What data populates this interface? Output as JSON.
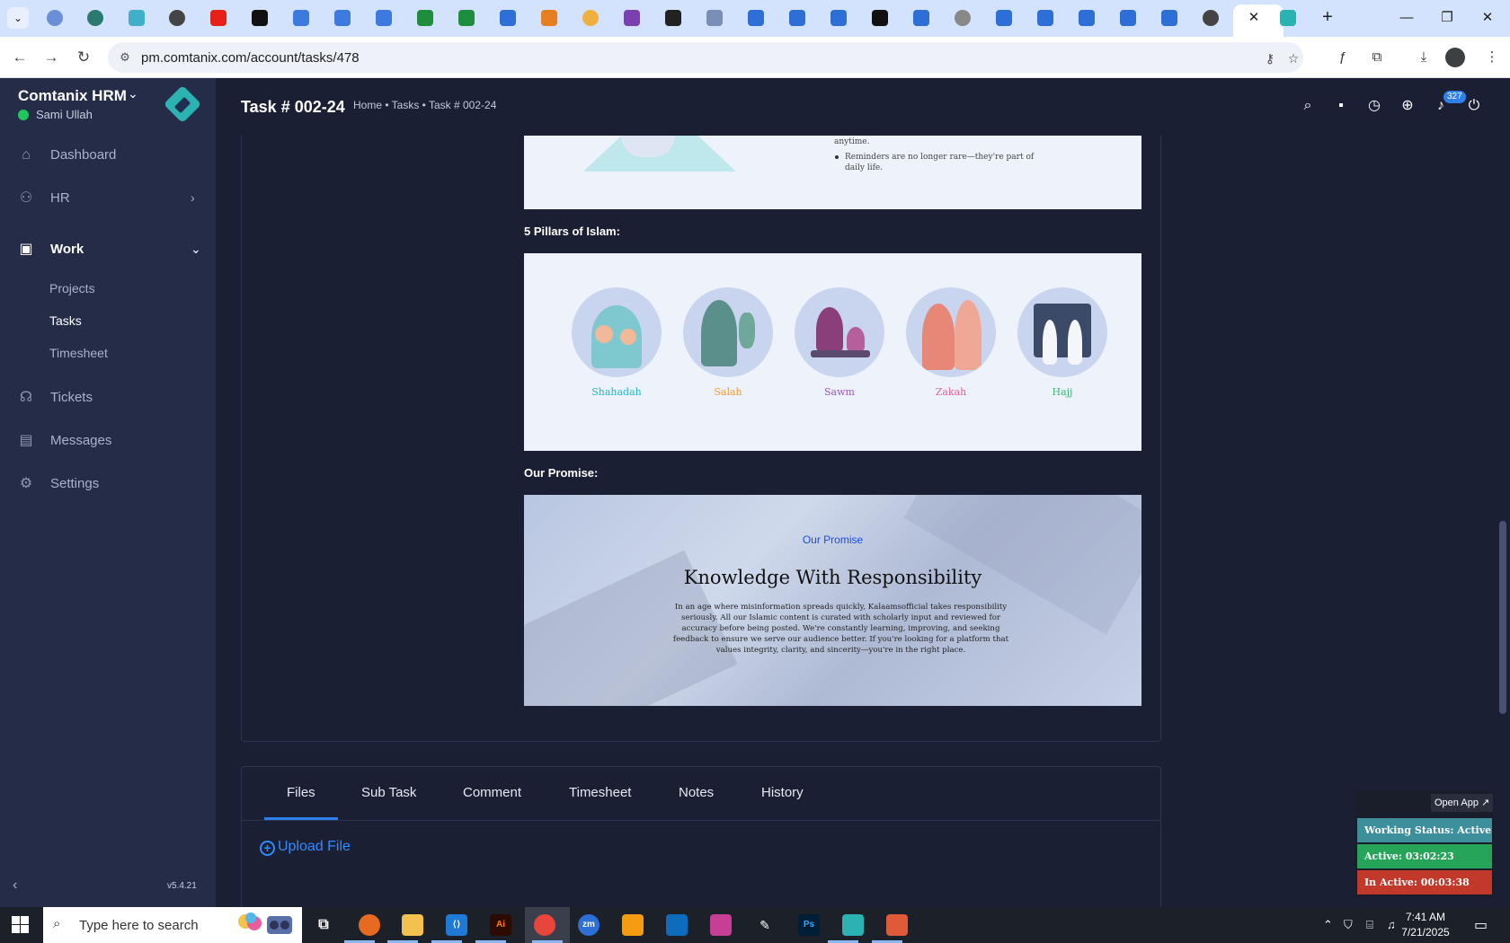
{
  "browser": {
    "url": "pm.comtanix.com/account/tasks/478",
    "tab_close_glyph": "✕",
    "new_tab_glyph": "+"
  },
  "sidebar": {
    "brand": "Comtanix HRM",
    "user": "Sami Ullah",
    "items": [
      {
        "label": "Dashboard",
        "icon": "home-icon"
      },
      {
        "label": "HR",
        "icon": "users-icon"
      },
      {
        "label": "Work",
        "icon": "briefcase-icon"
      },
      {
        "label": "Tickets",
        "icon": "headset-icon"
      },
      {
        "label": "Messages",
        "icon": "chat-icon"
      },
      {
        "label": "Settings",
        "icon": "gear-icon"
      }
    ],
    "work_sub": [
      "Projects",
      "Tasks",
      "Timesheet"
    ],
    "version": "v5.4.21"
  },
  "header": {
    "title": "Task # 002-24",
    "breadcrumb": "Home • Tasks • Task # 002-24",
    "notification_count": "327"
  },
  "content": {
    "top_bullets": {
      "first_line": "anytime.",
      "items": [
        "Reminders are no longer rare—they're part of daily life."
      ]
    },
    "pillars_heading": "5 Pillars of Islam:",
    "pillars": [
      {
        "label": "Shahadah",
        "color": "#22b8c8"
      },
      {
        "label": "Salah",
        "color": "#f39c3a"
      },
      {
        "label": "Sawm",
        "color": "#9b59c6"
      },
      {
        "label": "Zakah",
        "color": "#e9609a"
      },
      {
        "label": "Hajj",
        "color": "#2fbf71"
      }
    ],
    "promise_heading": "Our Promise:",
    "promise": {
      "eyebrow": "Our Promise",
      "title": "Knowledge With Responsibility",
      "body": "In an age where misinformation spreads quickly, Kalaamsofficial takes responsibility seriously. All our Islamic content is curated with scholarly input and reviewed for accuracy before being posted. We're constantly learning, improving, and seeking feedback to ensure we serve our audience better. If you're looking for a platform that values integrity, clarity, and sincerity—you're in the right place."
    }
  },
  "tabs": [
    "Files",
    "Sub Task",
    "Comment",
    "Timesheet",
    "Notes",
    "History"
  ],
  "active_tab": "Files",
  "upload_label": "Upload File",
  "widget": {
    "open_app": "Open App ↗",
    "working_status": "Working Status: Active",
    "active": "Active: 03:02:23",
    "inactive": "In Active: 00:03:38",
    "colors": {
      "working": "#3d8f9c",
      "active": "#26a55a",
      "inactive": "#c0392b"
    }
  },
  "taskbar": {
    "search_placeholder": "Type here to search",
    "time": "7:41 AM",
    "date": "7/21/2025"
  }
}
